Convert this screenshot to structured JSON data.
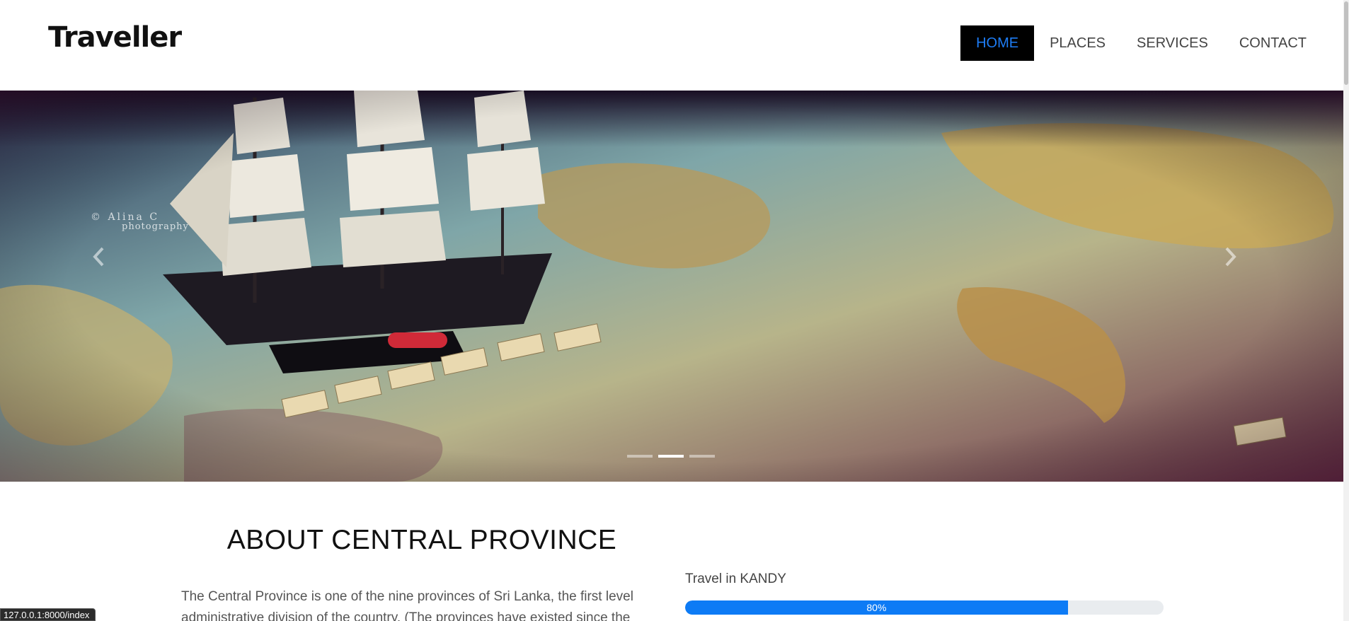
{
  "brand": "Traveller",
  "nav": {
    "items": [
      {
        "label": "HOME",
        "active": true
      },
      {
        "label": "PLACES",
        "active": false
      },
      {
        "label": "SERVICES",
        "active": false
      },
      {
        "label": "CONTACT",
        "active": false
      }
    ]
  },
  "carousel": {
    "watermark_line1": "© Alina C",
    "watermark_line2": "photography",
    "prev_icon": "chevron-left-icon",
    "next_icon": "chevron-right-icon",
    "indicators": 3,
    "active_indicator": 2
  },
  "about": {
    "title": "ABOUT CENTRAL PROVINCE",
    "text": "The Central Province is one of the nine provinces of Sri Lanka, the first level administrative division of the country. (The provinces have existed since the"
  },
  "progress": {
    "label": "Travel in KANDY",
    "value_text": "80%",
    "value": 0.8
  },
  "status_url": "127.0.0.1:8000/index",
  "colors": {
    "accent": "#0d7bf5",
    "nav_active_bg": "#000000",
    "nav_active_text": "#1e7df5"
  }
}
